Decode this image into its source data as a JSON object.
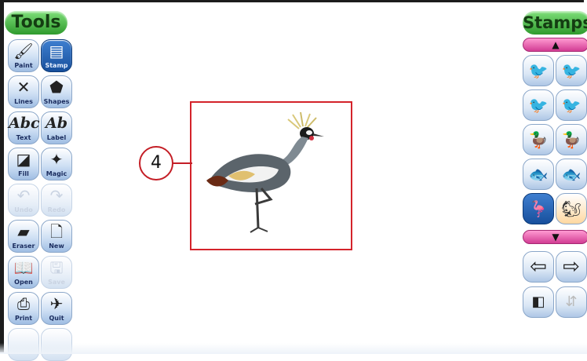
{
  "left_panel": {
    "title": "Tools"
  },
  "right_panel": {
    "title": "Stamps"
  },
  "tools": [
    {
      "label": "Paint",
      "icon": "🖌",
      "state": "normal"
    },
    {
      "label": "Stamp",
      "icon": "▤",
      "state": "selected"
    },
    {
      "label": "Lines",
      "icon": "✕",
      "state": "normal"
    },
    {
      "label": "Shapes",
      "icon": "⬟",
      "state": "normal"
    },
    {
      "label": "Text",
      "icon": "Abc",
      "state": "normal"
    },
    {
      "label": "Label",
      "icon": "Ab",
      "state": "normal"
    },
    {
      "label": "Fill",
      "icon": "◪",
      "state": "normal"
    },
    {
      "label": "Magic",
      "icon": "✦",
      "state": "normal"
    },
    {
      "label": "Undo",
      "icon": "↶",
      "state": "disabled"
    },
    {
      "label": "Redo",
      "icon": "↷",
      "state": "disabled"
    },
    {
      "label": "Eraser",
      "icon": "▰",
      "state": "normal"
    },
    {
      "label": "New",
      "icon": "🗋",
      "state": "normal"
    },
    {
      "label": "Open",
      "icon": "📖",
      "state": "normal"
    },
    {
      "label": "Save",
      "icon": "🖫",
      "state": "disabled"
    },
    {
      "label": "Print",
      "icon": "⎙",
      "state": "normal"
    },
    {
      "label": "Quit",
      "icon": "✈",
      "state": "normal"
    }
  ],
  "stamps": {
    "scroll_up_icon": "▲",
    "scroll_down_icon": "▼",
    "items": [
      {
        "icon": "bird-icon",
        "glyph": "🐦"
      },
      {
        "icon": "bird-icon",
        "glyph": "🐦"
      },
      {
        "icon": "bird-icon",
        "glyph": "🐦"
      },
      {
        "icon": "bird-icon",
        "glyph": "🐦"
      },
      {
        "icon": "duck-icon",
        "glyph": "🦆"
      },
      {
        "icon": "duck-icon",
        "glyph": "🦆"
      },
      {
        "icon": "fish-icon",
        "glyph": "🐟"
      },
      {
        "icon": "fish-icon",
        "glyph": "🐟"
      },
      {
        "icon": "crane-icon",
        "glyph": "🦩",
        "selected": true
      },
      {
        "icon": "squirrel-icon",
        "glyph": "🐿",
        "orange": true
      }
    ],
    "prev_icon": "⇦",
    "next_icon": "⇨",
    "flip_icon": "◧",
    "mirror_icon": "⇵"
  },
  "canvas": {
    "callout_number": "4",
    "stamp_subject": "crowned crane",
    "accent_color": "#d4232b"
  }
}
